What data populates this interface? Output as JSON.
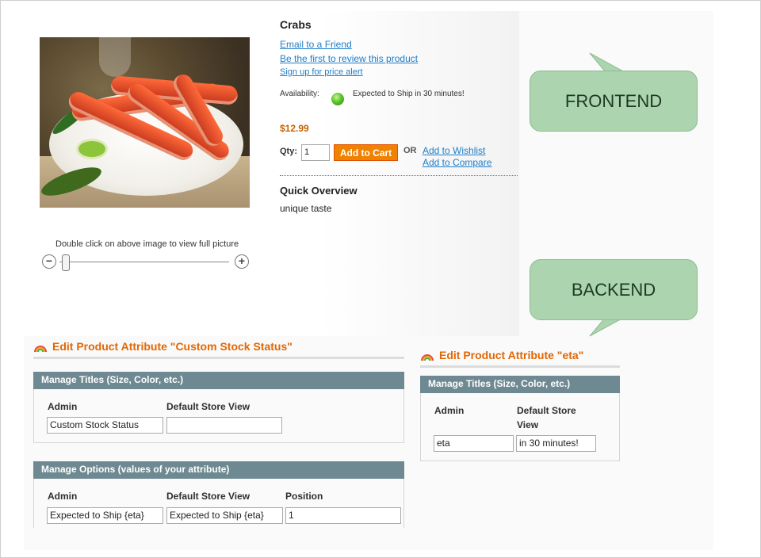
{
  "frontend": {
    "product_name": "Crabs",
    "email_friend": "Email to a Friend",
    "review_link": "Be the first to review this product",
    "price_alert": "Sign up for price alert",
    "availability_label": "Availability:",
    "availability_text": "Expected to Ship in 30 minutes!",
    "price": "$12.99",
    "qty_label": "Qty:",
    "qty_value": "1",
    "add_to_cart": "Add to Cart",
    "or_text": "OR",
    "add_wishlist": "Add to Wishlist",
    "add_compare": "Add to Compare",
    "quick_overview_title": "Quick Overview",
    "quick_overview_text": "unique taste",
    "zoom_caption": "Double click on above image to view  full picture",
    "zoom_minus": "−",
    "zoom_plus": "+",
    "availability_color": "#5cc42a",
    "cart_color": "#f18200",
    "link_color": "#1e7ec8"
  },
  "callouts": {
    "frontend": "FRONTEND",
    "backend": "BACKEND",
    "color": "#acd4ae"
  },
  "backend_left": {
    "title": "Edit Product Attribute \"Custom Stock Status\"",
    "titles_section": "Manage Titles (Size, Color, etc.)",
    "col_admin": "Admin",
    "col_default": "Default Store View",
    "admin_value": "Custom Stock Status",
    "default_value": "",
    "options_section": "Manage Options (values of your attribute)",
    "opt_col_admin": "Admin",
    "opt_col_default": "Default Store View",
    "opt_col_position": "Position",
    "opt_admin_value": "Expected to Ship {eta}",
    "opt_default_value": "Expected to Ship {eta}",
    "opt_position_value": "1"
  },
  "backend_right": {
    "title": "Edit Product Attribute \"eta\"",
    "titles_section": "Manage Titles (Size, Color, etc.)",
    "col_admin": "Admin",
    "col_default_line1": "Default Store",
    "col_default_line2": "View",
    "admin_value": "eta",
    "default_value": "in 30 minutes!"
  },
  "theme": {
    "header_color": "#e26703",
    "section_bar_color": "#6f8992"
  }
}
